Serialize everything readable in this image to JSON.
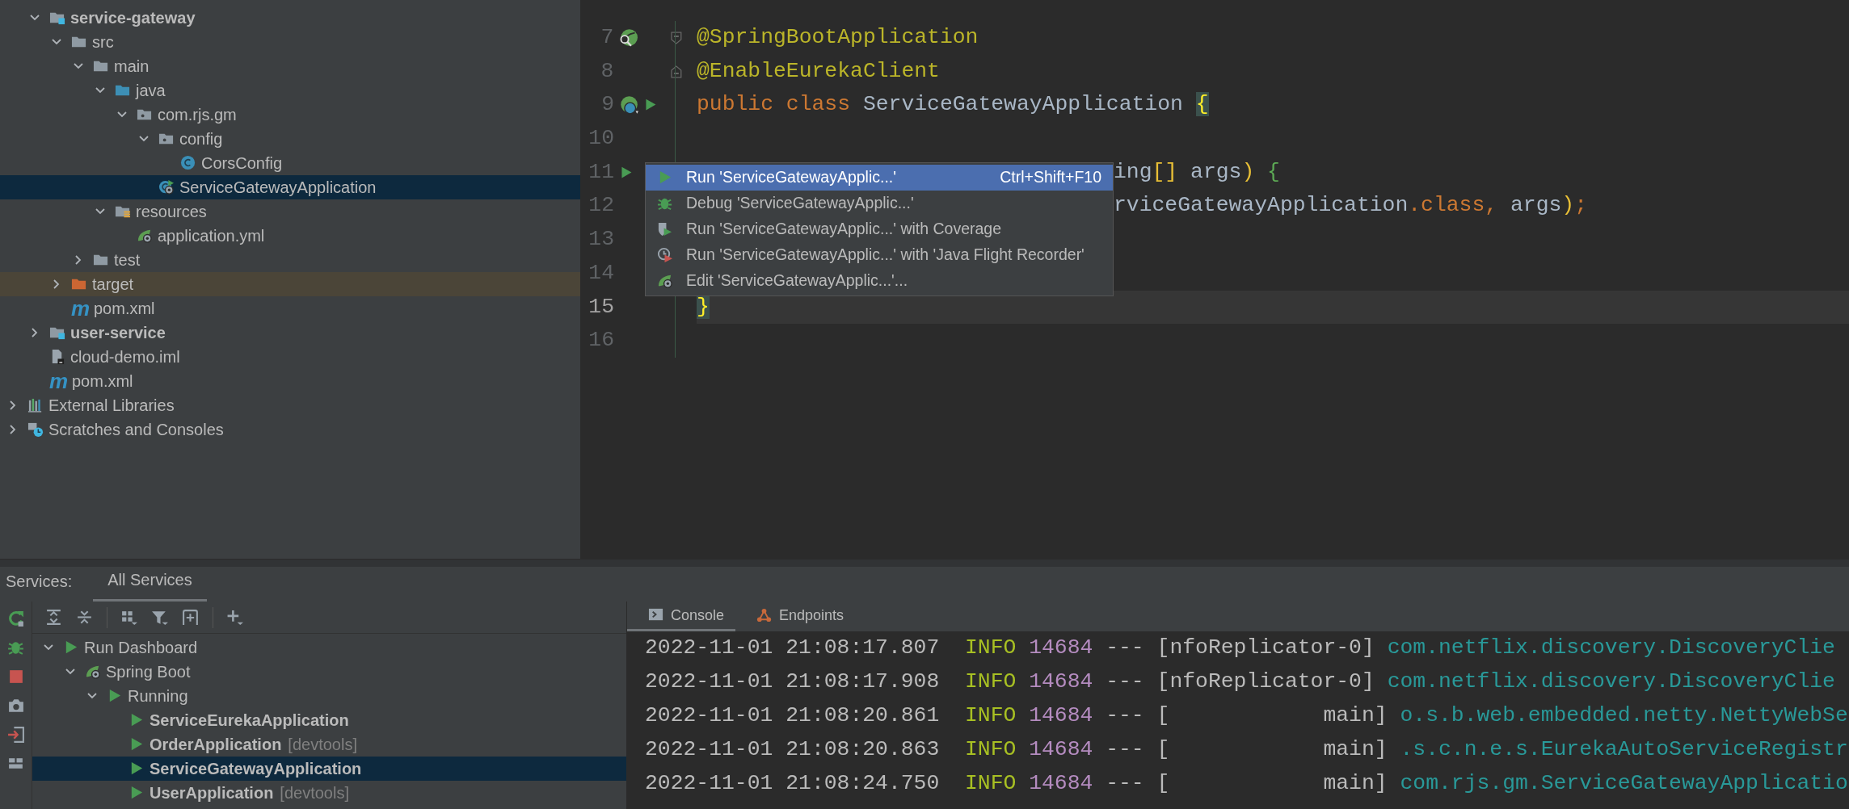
{
  "project_tree": [
    {
      "label": "service-gateway",
      "kind": "module",
      "expanded": true,
      "selected": false,
      "children": [
        {
          "label": "src",
          "kind": "folder",
          "expanded": true,
          "selected": false,
          "children": [
            {
              "label": "main",
              "kind": "folder",
              "expanded": true,
              "selected": false,
              "children": [
                {
                  "label": "java",
                  "kind": "source",
                  "expanded": true,
                  "selected": false,
                  "children": [
                    {
                      "label": "com.rjs.gm",
                      "kind": "package",
                      "expanded": true,
                      "selected": false,
                      "children": [
                        {
                          "label": "config",
                          "kind": "package",
                          "expanded": true,
                          "selected": false,
                          "children": [
                            {
                              "label": "CorsConfig",
                              "kind": "class",
                              "selected": false
                            }
                          ]
                        },
                        {
                          "label": "ServiceGatewayApplication",
                          "kind": "spring-class",
                          "selected": true
                        }
                      ]
                    }
                  ]
                },
                {
                  "label": "resources",
                  "kind": "resources",
                  "expanded": true,
                  "selected": false,
                  "children": [
                    {
                      "label": "application.yml",
                      "kind": "spring-config",
                      "selected": false
                    }
                  ]
                }
              ]
            },
            {
              "label": "test",
              "kind": "folder",
              "expanded": false,
              "selected": false
            }
          ]
        },
        {
          "label": "target",
          "kind": "excluded-folder",
          "expanded": false,
          "selected": false
        },
        {
          "label": "pom.xml",
          "kind": "maven",
          "glyph": "m",
          "selected": false
        }
      ]
    },
    {
      "label": "user-service",
      "kind": "module",
      "expanded": false,
      "selected": false
    },
    {
      "label": "cloud-demo.iml",
      "kind": "iml",
      "selected": false
    },
    {
      "label": "pom.xml",
      "kind": "maven",
      "glyph": "m",
      "selected": false
    }
  ],
  "root_items": [
    {
      "label": "External Libraries",
      "kind": "libraries",
      "expanded": false,
      "selected": false
    },
    {
      "label": "Scratches and Consoles",
      "kind": "scratches",
      "expanded": false,
      "selected": false
    }
  ],
  "editor": {
    "lines": [
      {
        "number": "7",
        "current": false,
        "gutter": [
          {
            "kind": "bean-search"
          }
        ],
        "fold": {
          "kind": "start"
        },
        "tokens": [
          {
            "t": "@SpringBootApplication",
            "kind": "annotation"
          }
        ]
      },
      {
        "number": "8",
        "current": false,
        "fold": {
          "kind": "end"
        },
        "tokens": [
          {
            "t": "@EnableEurekaClient",
            "kind": "annotation"
          }
        ]
      },
      {
        "number": "9",
        "current": false,
        "gutter": [
          {
            "kind": "bean-class"
          },
          {
            "kind": "run"
          }
        ],
        "tokens": [
          {
            "t": "public class ",
            "kind": "keyword"
          },
          {
            "t": "ServiceGatewayApplication ",
            "kind": "ident"
          },
          {
            "t": "{",
            "kind": "brace-match"
          }
        ]
      },
      {
        "number": "10",
        "current": false
      },
      {
        "number": "11",
        "current": false,
        "covered": true,
        "gutter": [
          {
            "kind": "run"
          }
        ],
        "tokens": [
          {
            "t": "ing",
            "kind": "ident"
          },
          {
            "t": "[]",
            "kind": "paren"
          },
          {
            "t": " args",
            "kind": "ident"
          },
          {
            "t": ")",
            "kind": "paren"
          },
          {
            "t": " {",
            "kind": "brace"
          }
        ]
      },
      {
        "number": "12",
        "current": false,
        "covered": true,
        "tokens": [
          {
            "t": "rviceGatewayApplication",
            "kind": "ident"
          },
          {
            "t": ".class, ",
            "kind": "keyword"
          },
          {
            "t": "args",
            "kind": "ident"
          },
          {
            "t": ")",
            "kind": "paren"
          },
          {
            "t": ";",
            "kind": "keyword"
          }
        ]
      },
      {
        "number": "13",
        "current": false
      },
      {
        "number": "14",
        "current": false
      },
      {
        "number": "15",
        "current": true,
        "tokens": [
          {
            "t": "}",
            "kind": "brace-match"
          }
        ]
      },
      {
        "number": "16",
        "current": false
      }
    ]
  },
  "context_menu": [
    {
      "kind": "run",
      "label": "Run 'ServiceGatewayApplic...'",
      "shortcut": "Ctrl+Shift+F10",
      "selected": true
    },
    {
      "kind": "debug",
      "label": "Debug 'ServiceGatewayApplic...'",
      "selected": false
    },
    {
      "kind": "coverage",
      "label": "Run 'ServiceGatewayApplic...' with Coverage",
      "selected": false
    },
    {
      "kind": "profiler",
      "label": "Run 'ServiceGatewayApplic...' with 'Java Flight Recorder'",
      "selected": false
    },
    {
      "kind": "edit",
      "label": "Edit 'ServiceGatewayApplic...'...",
      "selected": false
    }
  ],
  "services": {
    "title": "Services:",
    "tabs": [
      {
        "label": "All Services",
        "selected": true
      }
    ],
    "tree": [
      {
        "label": "Run Dashboard",
        "kind": "group",
        "expanded": true,
        "selected": false,
        "children": [
          {
            "label": "Spring Boot",
            "kind": "spring-boot",
            "expanded": true,
            "selected": false,
            "children": [
              {
                "label": "Running",
                "kind": "group",
                "expanded": true,
                "selected": false,
                "children": [
                  {
                    "label": "ServiceEurekaApplication",
                    "kind": "app",
                    "selected": false
                  },
                  {
                    "label": "OrderApplication",
                    "kind": "app",
                    "tag": "[devtools]",
                    "selected": false
                  },
                  {
                    "label": "ServiceGatewayApplication",
                    "kind": "app",
                    "selected": true
                  },
                  {
                    "label": "UserApplication",
                    "kind": "app",
                    "tag": "[devtools]",
                    "selected": false
                  }
                ]
              }
            ]
          }
        ]
      }
    ]
  },
  "console": {
    "tabs": [
      {
        "label": "Console",
        "kind": "console",
        "selected": true
      },
      {
        "label": "Endpoints",
        "kind": "endpoints",
        "selected": false
      }
    ],
    "lines": [
      {
        "time": "2022-11-01 21:08:17.807",
        "level": "INFO",
        "pid": "14684",
        "sep": "---",
        "thread": "[nfoReplicator-0]",
        "logger": "com.netflix.discovery.DiscoveryClie"
      },
      {
        "time": "2022-11-01 21:08:17.908",
        "level": "INFO",
        "pid": "14684",
        "sep": "---",
        "thread": "[nfoReplicator-0]",
        "logger": "com.netflix.discovery.DiscoveryClie"
      },
      {
        "time": "2022-11-01 21:08:20.861",
        "level": "INFO",
        "pid": "14684",
        "sep": "---",
        "thread": "[            main]",
        "logger": "o.s.b.web.embedded.netty.NettyWebSe"
      },
      {
        "time": "2022-11-01 21:08:20.863",
        "level": "INFO",
        "pid": "14684",
        "sep": "---",
        "thread": "[            main]",
        "logger": ".s.c.n.e.s.EurekaAutoServiceRegistr"
      },
      {
        "time": "2022-11-01 21:08:24.750",
        "level": "INFO",
        "pid": "14684",
        "sep": "---",
        "thread": "[            main]",
        "logger": "com.rjs.gm.ServiceGatewayApplicatio"
      }
    ]
  }
}
